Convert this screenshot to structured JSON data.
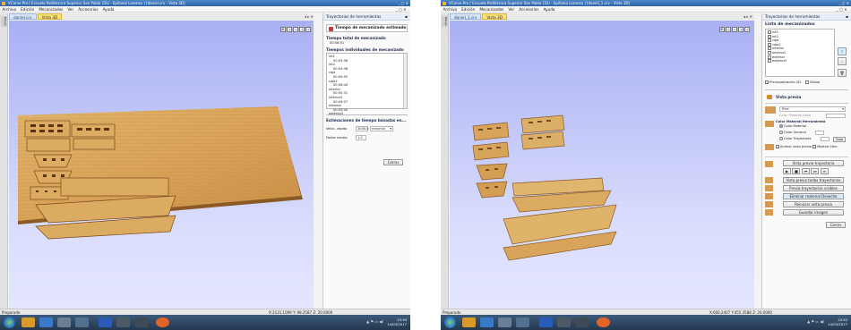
{
  "left": {
    "titlebar": "VCarve Pro [ Escuela Politécnica Superior San Pablo CEU - Epifanio Lorenzo ] [daniel.crv - Vista 3D]",
    "window_controls": "_ ▢ ✕",
    "menu": [
      "Archivo",
      "Edición",
      "Mecanizados",
      "Ver",
      "Accesorios",
      "Ayuda"
    ],
    "menu_controls": "_ ▢ ✕",
    "tabs": [
      "daniel.crv",
      "Vista 3D"
    ],
    "side_tab": "Dibujo",
    "pin_controls": "◂ ▸ ✕",
    "view_icons": [
      "⊞",
      "⊥",
      "⟂",
      "⊥",
      "⊥"
    ],
    "panel": {
      "title": "Trayectorias de herramientas",
      "pin": "▪",
      "header": "Tiempo de mecanizado estimado",
      "total_label": "Tiempo total de mecanizado",
      "total_value": "00:58:51",
      "individual_label": "Tiempos individuales de mecanizado",
      "times": [
        {
          "name": "int1",
          "time": "00:03:36"
        },
        {
          "name": "int2",
          "time": "00:03:36"
        },
        {
          "name": "caja",
          "time": "00:09:55"
        },
        {
          "name": "caja2",
          "time": "00:06:44"
        },
        {
          "name": "interior",
          "time": "00:05:31"
        },
        {
          "name": "interior2",
          "time": "00:04:07"
        },
        {
          "name": "exterior",
          "time": "00:05:00"
        },
        {
          "name": "exterior2",
          "time": ""
        }
      ],
      "estimates_label": "Estimaciones de tiempo basadas en...",
      "speed_label": "Veloc. rápida",
      "speed_value": "3000.0",
      "speed_unit": "mm/min",
      "scale_label": "Factor escala",
      "scale_value": "1.0",
      "close_button": "Cerrar"
    },
    "status_left": "Preparado",
    "status_right": "X:2131.1009 Y: 98.2587 Z: 20.0000",
    "clock_time": "15:30",
    "clock_date": "14/03/2017",
    "tray": "▲ ⚑ ▭ ◀)"
  },
  "right": {
    "titlebar": "VCarve Pro [ Escuela Politécnica Superior San Pablo CEU - Epifanio Lorenzo ] [daniel_1.crv - Vista 3D]",
    "window_controls": "_ ▢ ✕",
    "menu": [
      "Archivo",
      "Edición",
      "Mecanizados",
      "Ver",
      "Accesorios",
      "Ayuda"
    ],
    "menu_controls": "_ ▢ ✕",
    "tabs": [
      "daniel_1.crv",
      "Vista 3D"
    ],
    "side_tab": "Dibujo",
    "pin_controls": "◂ ▸ ✕",
    "view_icons": [
      "⊞",
      "⊥",
      "⟂",
      "⊥",
      "⊥"
    ],
    "panel": {
      "title": "Trayectorias de herramientas",
      "pin": "▪",
      "list_title": "Lista de mecanizados",
      "toolpaths": [
        "int1",
        "int2",
        "caja",
        "caja2",
        "interior",
        "interior2",
        "exterior",
        "exterior2"
      ],
      "side_buttons": [
        "⇧",
        "⇩",
        "🗑"
      ],
      "preview_toolpath": "Previsualización 2D",
      "solid": "Sólida",
      "preview_header": "Vista previa",
      "material_select": "Pine",
      "color_material_solid": "Color Material Sólid",
      "color_header": "Color Material Herramienta",
      "radio_color_material": "Color Material",
      "radio_color_general": "Color General",
      "radio_color_path": "Color Trayectoria",
      "all_button": "Todo",
      "animate_label": "Animar vista previa",
      "show_tool_label": "Mostrar Herr.",
      "btn_preview_path": "Vista previa trayectoria",
      "playback": [
        "▶",
        "■",
        "⏮",
        "⏭",
        "≡"
      ],
      "btn_preview_all": "Vista previa todas trayectorias",
      "btn_preview_visible": "Previa trayectorias visibles",
      "btn_remove_material": "Eliminar material Desecho",
      "btn_reset_preview": "Reiniciar vista previa",
      "btn_save_image": "Guardar imagen",
      "close_button": "Cerrar"
    },
    "status_left": "Preparado",
    "status_right": "X:600.2407 Y:455.3588 Z: 20.0000",
    "clock_time": "15:32",
    "clock_date": "14/03/2017",
    "tray": "▲ ⚑ ▭ ◀)"
  }
}
